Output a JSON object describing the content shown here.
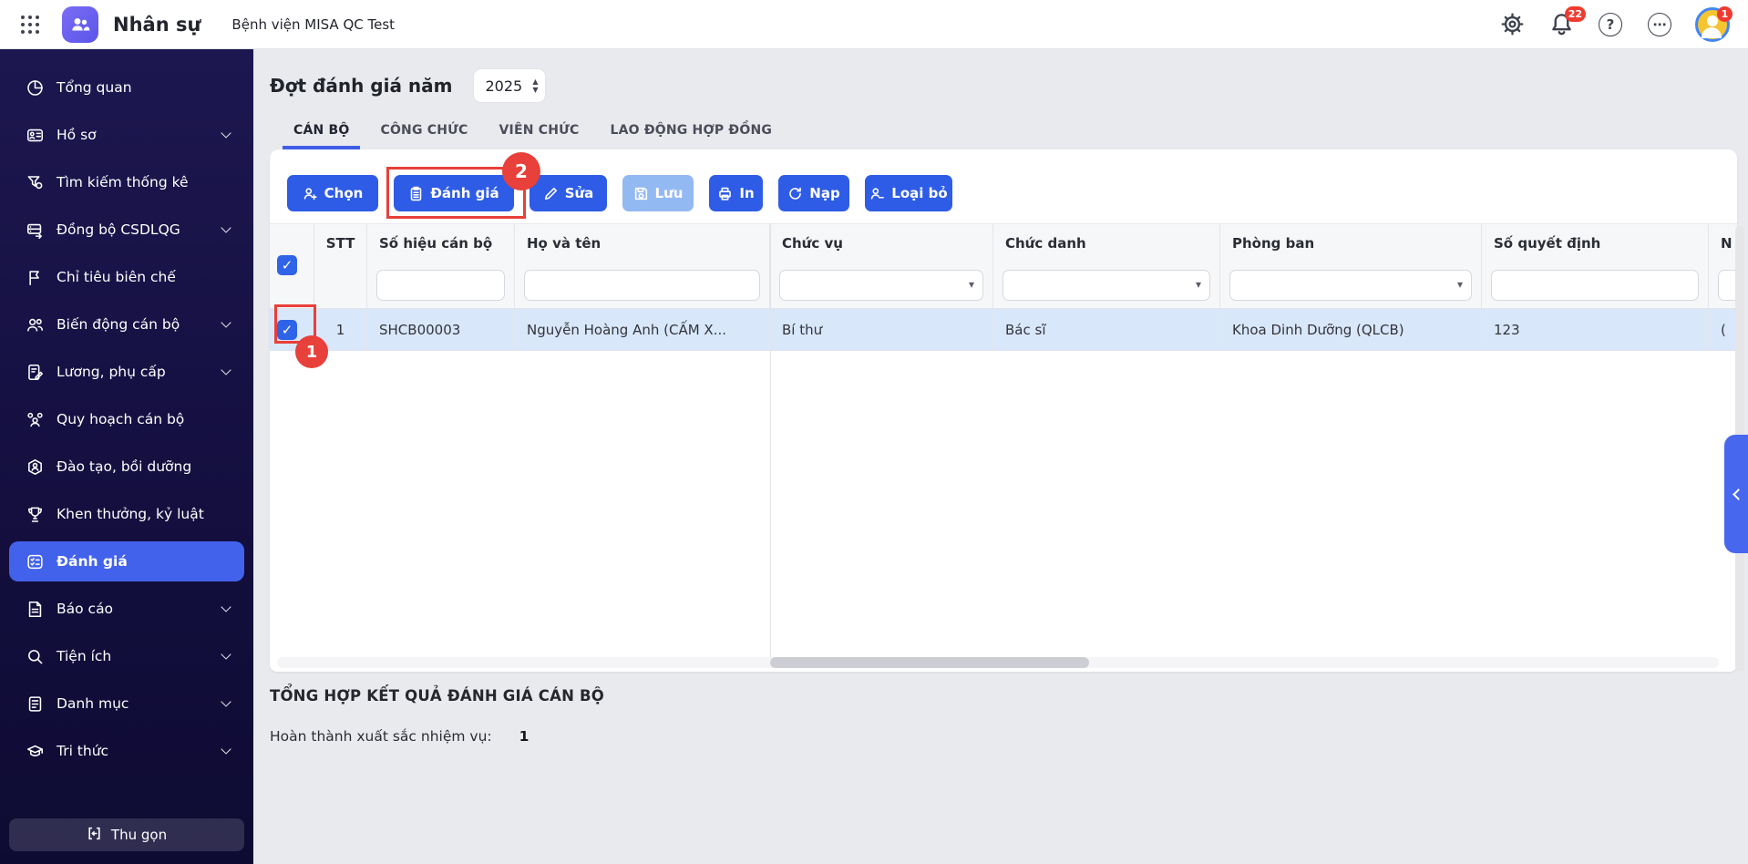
{
  "topbar": {
    "app_title": "Nhân sự",
    "org_name": "Bệnh viện MISA QC Test",
    "notification_badge": "22",
    "avatar_badge": "1"
  },
  "sidebar": {
    "items": [
      {
        "label": "Tổng quan",
        "icon": "pie-chart",
        "expandable": false,
        "active": false
      },
      {
        "label": "Hồ sơ",
        "icon": "id-card",
        "expandable": true,
        "active": false
      },
      {
        "label": "Tìm kiếm thống kê",
        "icon": "filter",
        "expandable": false,
        "active": false
      },
      {
        "label": "Đồng bộ CSDLQG",
        "icon": "database-sync",
        "expandable": true,
        "active": false
      },
      {
        "label": "Chỉ tiêu biên chế",
        "icon": "flag",
        "expandable": false,
        "active": false
      },
      {
        "label": "Biến động cán bộ",
        "icon": "users",
        "expandable": true,
        "active": false
      },
      {
        "label": "Lương, phụ cấp",
        "icon": "document-pen",
        "expandable": true,
        "active": false
      },
      {
        "label": "Quy hoạch cán bộ",
        "icon": "org-chart",
        "expandable": false,
        "active": false
      },
      {
        "label": "Đào tạo, bồi dưỡng",
        "icon": "user-hexagon",
        "expandable": false,
        "active": false
      },
      {
        "label": "Khen thưởng, kỷ luật",
        "icon": "trophy",
        "expandable": false,
        "active": false
      },
      {
        "label": "Đánh giá",
        "icon": "checklist",
        "expandable": false,
        "active": true
      },
      {
        "label": "Báo cáo",
        "icon": "report",
        "expandable": true,
        "active": false
      },
      {
        "label": "Tiện ích",
        "icon": "magnifier",
        "expandable": true,
        "active": false
      },
      {
        "label": "Danh mục",
        "icon": "list",
        "expandable": true,
        "active": false
      },
      {
        "label": "Tri thức",
        "icon": "graduation-cap",
        "expandable": true,
        "active": false
      }
    ],
    "collapse_label": "Thu gọn"
  },
  "page": {
    "heading": "Đợt đánh giá năm",
    "year_value": "2025"
  },
  "tabs": [
    {
      "label": "CÁN BỘ",
      "active": true
    },
    {
      "label": "CÔNG CHỨC",
      "active": false
    },
    {
      "label": "VIÊN CHỨC",
      "active": false
    },
    {
      "label": "LAO ĐỘNG HỢP ĐỒNG",
      "active": false
    }
  ],
  "toolbar": {
    "buttons": [
      {
        "label": "Chọn",
        "icon": "user-plus",
        "disabled": false
      },
      {
        "label": "Đánh giá",
        "icon": "clipboard",
        "disabled": false
      },
      {
        "label": "Sửa",
        "icon": "pencil",
        "disabled": false
      },
      {
        "label": "Lưu",
        "icon": "save",
        "disabled": true
      },
      {
        "label": "In",
        "icon": "printer",
        "disabled": false
      },
      {
        "label": "Nạp",
        "icon": "refresh",
        "disabled": false
      },
      {
        "label": "Loại bỏ",
        "icon": "user-minus",
        "disabled": false
      }
    ]
  },
  "annotations": {
    "step_1": "1",
    "step_2": "2",
    "highlight_color": "#e8403a"
  },
  "table": {
    "columns": [
      "STT",
      "Số hiệu cán bộ",
      "Họ và tên",
      "Chức vụ",
      "Chức danh",
      "Phòng ban",
      "Số quyết định",
      "N"
    ],
    "filters": [
      {
        "column": "Số hiệu cán bộ",
        "type": "text",
        "value": ""
      },
      {
        "column": "Họ và tên",
        "type": "text",
        "value": ""
      },
      {
        "column": "Chức vụ",
        "type": "select",
        "value": ""
      },
      {
        "column": "Chức danh",
        "type": "select",
        "value": ""
      },
      {
        "column": "Phòng ban",
        "type": "select",
        "value": ""
      },
      {
        "column": "Số quyết định",
        "type": "text",
        "value": ""
      }
    ],
    "row": {
      "selected": true,
      "stt": "1",
      "code": "SHCB00003",
      "name": "Nguyễn Hoàng Anh (CẤM X...",
      "position": "Bí thư",
      "title": "Bác sĩ",
      "department": "Khoa Dinh Dưỡng (QLCB)",
      "decision_no": "123",
      "clipped": "("
    }
  },
  "summary": {
    "title": "TỔNG HỢP KẾT QUẢ ĐÁNH GIÁ CÁN BỘ",
    "label": "Hoàn thành xuất sắc nhiệm vụ:",
    "value": "1"
  },
  "colors": {
    "primary_blue": "#2e5ce6",
    "active_blue": "#4262eb",
    "disabled_blue": "#93b9f3",
    "row_highlight": "#d9e7fa",
    "annotation_red": "#e8403a",
    "sidebar_bg": "#171243",
    "badge_red": "#f03b30"
  }
}
